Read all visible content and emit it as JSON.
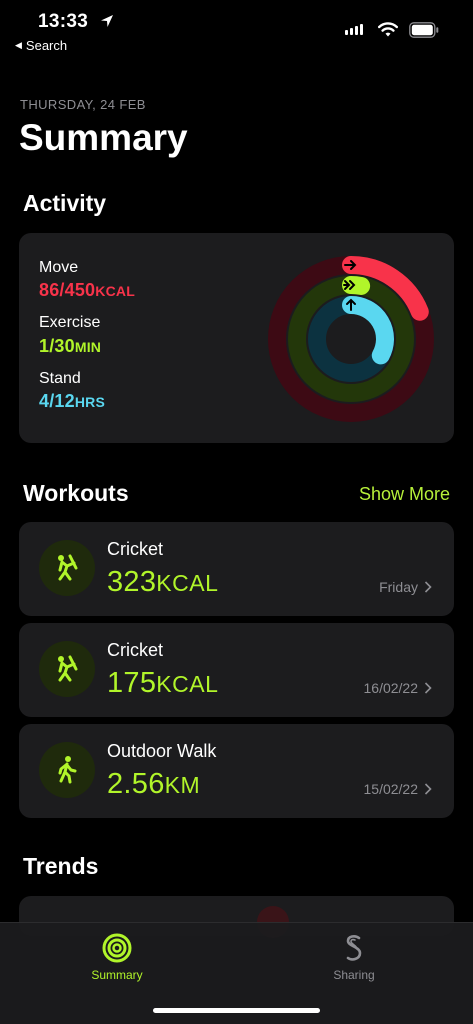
{
  "status": {
    "time": "13:33",
    "back_label": "Search"
  },
  "header": {
    "date": "THURSDAY, 24 FEB",
    "title": "Summary"
  },
  "activity": {
    "heading": "Activity",
    "move": {
      "label": "Move",
      "value": "86/450",
      "unit": "KCAL",
      "progress": 0.19,
      "color": "#f8334a"
    },
    "exercise": {
      "label": "Exercise",
      "value": "1/30",
      "unit": "MIN",
      "progress": 0.03,
      "color": "#b1f52a"
    },
    "stand": {
      "label": "Stand",
      "value": "4/12",
      "unit": "HRS",
      "progress": 0.33,
      "color": "#5ad7f0"
    }
  },
  "workouts": {
    "heading": "Workouts",
    "show_more": "Show More",
    "items": [
      {
        "name": "Cricket",
        "value": "323",
        "unit": "KCAL",
        "date": "Friday",
        "icon": "cricket-icon"
      },
      {
        "name": "Cricket",
        "value": "175",
        "unit": "KCAL",
        "date": "16/02/22",
        "icon": "cricket-icon"
      },
      {
        "name": "Outdoor Walk",
        "value": "2.56",
        "unit": "KM",
        "date": "15/02/22",
        "icon": "walk-icon"
      }
    ]
  },
  "trends": {
    "heading": "Trends"
  },
  "tabbar": {
    "summary": "Summary",
    "sharing": "Sharing"
  },
  "colors": {
    "accent": "#b1f52a",
    "background": "#000000",
    "card": "#1c1c1e"
  }
}
